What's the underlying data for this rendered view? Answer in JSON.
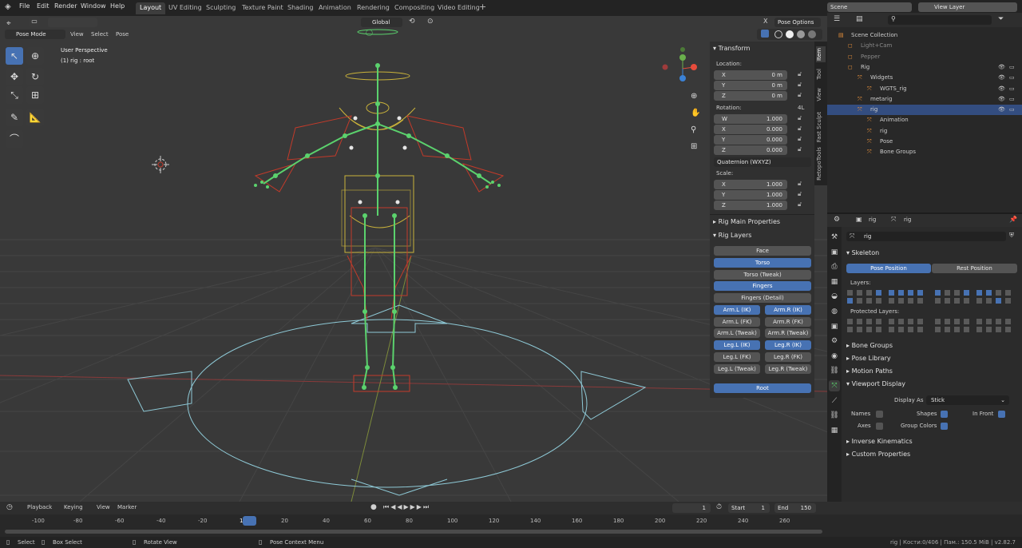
{
  "menu": {
    "file": "File",
    "edit": "Edit",
    "render": "Render",
    "window": "Window",
    "help": "Help"
  },
  "workspaces": [
    "Layout",
    "UV Editing",
    "Sculpting",
    "Texture Paint",
    "Shading",
    "Animation",
    "Rendering",
    "Compositing",
    "Video Editing"
  ],
  "scene": "Scene",
  "view_layer": "View Layer",
  "viewport": {
    "mode": "Pose Mode",
    "menus": [
      "View",
      "Select",
      "Pose"
    ],
    "orientation": "Global",
    "pose_options": "Pose Options",
    "perspective": "User Perspective",
    "object": "(1) rig : root"
  },
  "npanel": {
    "transform": "Transform",
    "location": "Location:",
    "loc": [
      {
        "axis": "X",
        "value": "0 m"
      },
      {
        "axis": "Y",
        "value": "0 m"
      },
      {
        "axis": "Z",
        "value": "0 m"
      }
    ],
    "rotation": "Rotation:",
    "rot_mode_label": "4L",
    "rot": [
      {
        "axis": "W",
        "value": "1.000"
      },
      {
        "axis": "X",
        "value": "0.000"
      },
      {
        "axis": "Y",
        "value": "0.000"
      },
      {
        "axis": "Z",
        "value": "0.000"
      }
    ],
    "quat": "Quaternion (WXYZ)",
    "scale": "Scale:",
    "scl": [
      {
        "axis": "X",
        "value": "1.000"
      },
      {
        "axis": "Y",
        "value": "1.000"
      },
      {
        "axis": "Z",
        "value": "1.000"
      }
    ],
    "rig_main": "Rig Main Properties",
    "rig_layers": "Rig Layers",
    "single": [
      {
        "label": "Face",
        "on": false
      },
      {
        "label": "Torso",
        "on": true
      },
      {
        "label": "Torso (Tweak)",
        "on": false
      },
      {
        "label": "Fingers",
        "on": true
      },
      {
        "label": "Fingers (Detail)",
        "on": false
      }
    ],
    "pairs": [
      [
        "Arm.L (IK)",
        true,
        "Arm.R (IK)",
        true
      ],
      [
        "Arm.L (FK)",
        false,
        "Arm.R (FK)",
        false
      ],
      [
        "Arm.L (Tweak)",
        false,
        "Arm.R (Tweak)",
        false
      ],
      [
        "Leg.L (IK)",
        true,
        "Leg.R (IK)",
        true
      ],
      [
        "Leg.L (FK)",
        false,
        "Leg.R (FK)",
        false
      ],
      [
        "Leg.L (Tweak)",
        false,
        "Leg.R (Tweak)",
        false
      ]
    ],
    "root": "Root",
    "tabs": [
      "Item",
      "Tool",
      "View",
      "Fast Sculpt",
      "RetopoTools"
    ]
  },
  "outliner": {
    "rows": [
      {
        "label": "Scene Collection",
        "indent": 0
      },
      {
        "label": "Light+Cam",
        "indent": 1
      },
      {
        "label": "Pepper",
        "indent": 1
      },
      {
        "label": "Rig",
        "indent": 1
      },
      {
        "label": "Widgets",
        "indent": 2
      },
      {
        "label": "WGTS_rig",
        "indent": 3
      },
      {
        "label": "metarig",
        "indent": 2
      },
      {
        "label": "rig",
        "indent": 2
      },
      {
        "label": "Animation",
        "indent": 3
      },
      {
        "label": "rig",
        "indent": 3
      },
      {
        "label": "Pose",
        "indent": 3
      },
      {
        "label": "Bone Groups",
        "indent": 3
      }
    ]
  },
  "props": {
    "header_obj": "rig",
    "header_data": "rig",
    "name_field": "rig",
    "skeleton": "Skeleton",
    "pose_position": "Pose Position",
    "rest_position": "Rest Position",
    "layers": "Layers:",
    "protected_layers": "Protected Layers:",
    "sections": [
      "Bone Groups",
      "Pose Library",
      "Motion Paths"
    ],
    "viewport_display": "Viewport Display",
    "display_as_label": "Display As",
    "display_as": "Stick",
    "names": "Names",
    "shapes": "Shapes",
    "in_front": "In Front",
    "axes": "Axes",
    "group_colors": "Group Colors",
    "more": [
      "Inverse Kinematics",
      "Custom Properties"
    ]
  },
  "timeline": {
    "menus": [
      "Playback",
      "Keying",
      "View",
      "Marker"
    ],
    "current": "1",
    "start_label": "Start",
    "start": "1",
    "end_label": "End",
    "end": "150",
    "ticks": [
      "-100",
      "-80",
      "-60",
      "-40",
      "-20",
      "1",
      "20",
      "40",
      "60",
      "80",
      "100",
      "120",
      "140",
      "160",
      "180",
      "200",
      "220",
      "240",
      "260"
    ]
  },
  "status": {
    "select": "Select",
    "box_select": "Box Select",
    "rotate_view": "Rotate View",
    "pose_context": "Pose Context Menu",
    "right": "rig | Кости:0/406 | Пам.: 150.5 MiB | v2.82.7"
  }
}
